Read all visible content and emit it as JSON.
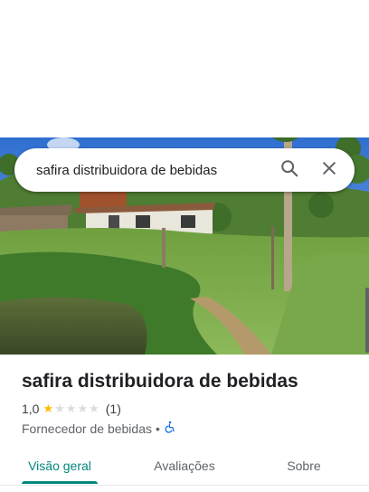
{
  "search": {
    "value": "safira distribuidora de bebidas",
    "search_icon": "search-icon",
    "close_icon": "close-icon"
  },
  "place": {
    "title": "safira distribuidora de bebidas",
    "rating": "1,0",
    "stars_filled": 1,
    "stars_total": 5,
    "review_count": "(1)",
    "category": "Fornecedor de bebidas",
    "separator": "•",
    "accessibility_icon": "wheelchair-icon"
  },
  "tabs": [
    {
      "label": "Visão geral",
      "active": true
    },
    {
      "label": "Avaliações",
      "active": false
    },
    {
      "label": "Sobre",
      "active": false
    }
  ],
  "colors": {
    "accent": "#01877e",
    "star": "#fbbc04",
    "accessibility": "#1a73e8"
  }
}
